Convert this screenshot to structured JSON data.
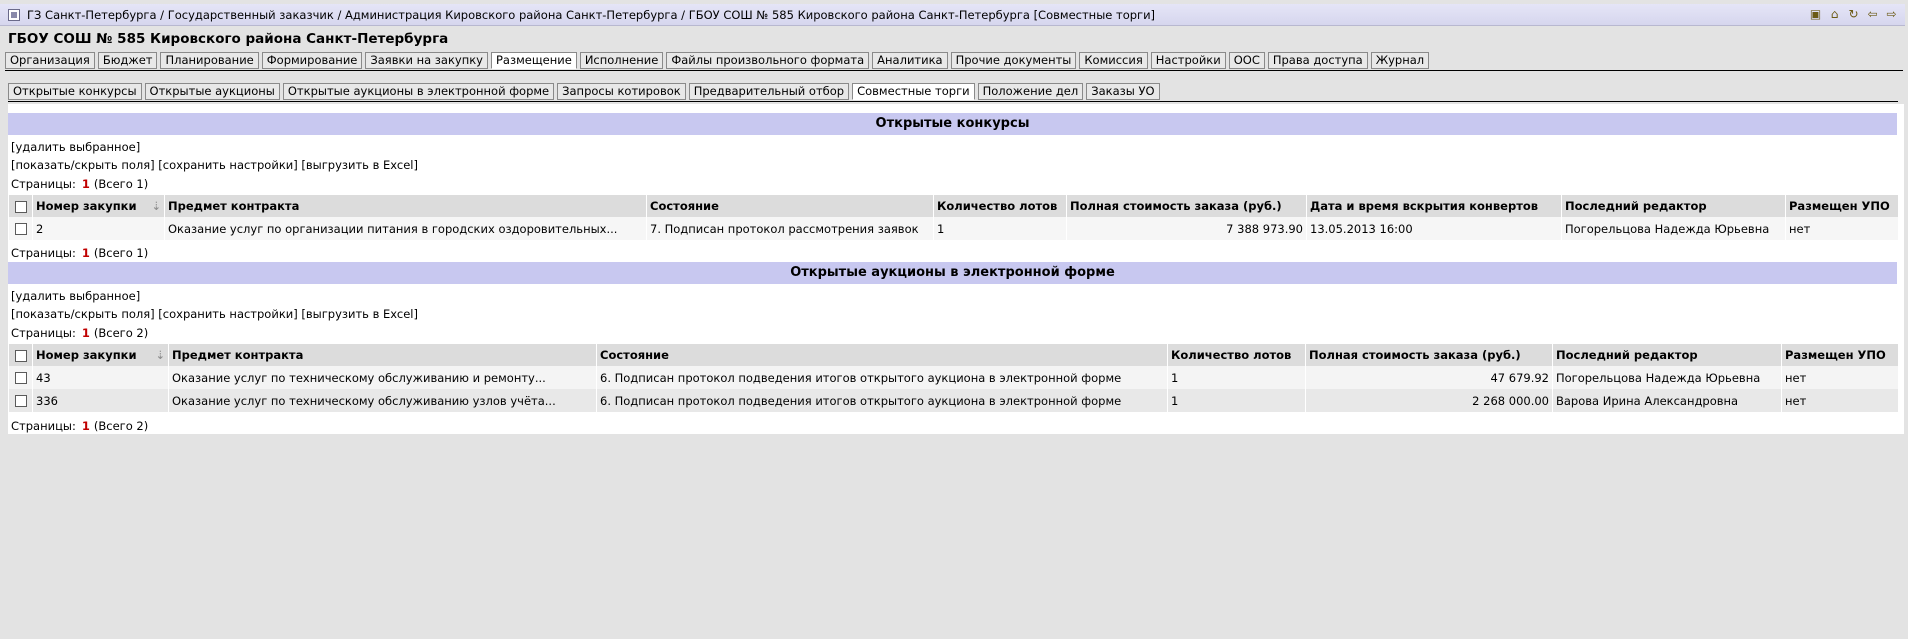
{
  "titlebar": {
    "path": "ГЗ Санкт-Петербурга / Государственный заказчик / Администрация Кировского района Санкт-Петербурга / ГБОУ СОШ № 585 Кировского района Санкт-Петербурга [Совместные торги]"
  },
  "org_title": "ГБОУ СОШ № 585 Кировского района Санкт-Петербурга",
  "main_tabs": [
    "Организация",
    "Бюджет",
    "Планирование",
    "Формирование",
    "Заявки на закупку",
    "Размещение",
    "Исполнение",
    "Файлы произвольного формата",
    "Аналитика",
    "Прочие документы",
    "Комиссия",
    "Настройки",
    "ООС",
    "Права доступа",
    "Журнал"
  ],
  "sub_tabs": [
    "Открытые конкурсы",
    "Открытые аукционы",
    "Открытые аукционы в электронной форме",
    "Запросы котировок",
    "Предварительный отбор",
    "Совместные торги",
    "Положение дел",
    "Заказы УО"
  ],
  "actions": {
    "delete": "[удалить выбранное]",
    "toggle_fields": "[показать/скрыть поля]",
    "save_settings": "[сохранить настройки]",
    "export_excel": "[выгрузить в Excel]"
  },
  "pager": {
    "label": "Страницы:"
  },
  "section1": {
    "title": "Открытые конкурсы",
    "current_page": "1",
    "total": "(Всего 1)",
    "headers": [
      "Номер закупки",
      "Предмет контракта",
      "Состояние",
      "Количество лотов",
      "Полная стоимость заказа (руб.)",
      "Дата и время вскрытия конвертов",
      "Последний редактор",
      "Размещен УПО"
    ],
    "rows": [
      [
        "2",
        "Оказание услуг по организации питания в городских оздоровительных...",
        "7. Подписан протокол рассмотрения заявок",
        "1",
        "7 388 973.90",
        "13.05.2013 16:00",
        "Погорельцова Надежда Юрьевна",
        "нет"
      ]
    ]
  },
  "section2": {
    "title": "Открытые аукционы в электронной форме",
    "current_page": "1",
    "total": "(Всего 2)",
    "headers": [
      "Номер закупки",
      "Предмет контракта",
      "Состояние",
      "Количество лотов",
      "Полная стоимость заказа (руб.)",
      "Последний редактор",
      "Размещен УПО"
    ],
    "rows": [
      [
        "43",
        "Оказание услуг по техническому обслуживанию и ремонту...",
        "6. Подписан протокол подведения итогов открытого аукциона в электронной форме",
        "1",
        "47 679.92",
        "Погорельцова Надежда Юрьевна",
        "нет"
      ],
      [
        "336",
        "Оказание услуг по техническому обслуживанию узлов учёта...",
        "6. Подписан протокол подведения итогов открытого аукциона в электронной форме",
        "1",
        "2 268 000.00",
        "Варова Ирина Александровна",
        "нет"
      ]
    ]
  },
  "colors": {
    "section_header": "#c8c8f0",
    "page_number": "#c00000",
    "background": "#e3e3e3"
  }
}
